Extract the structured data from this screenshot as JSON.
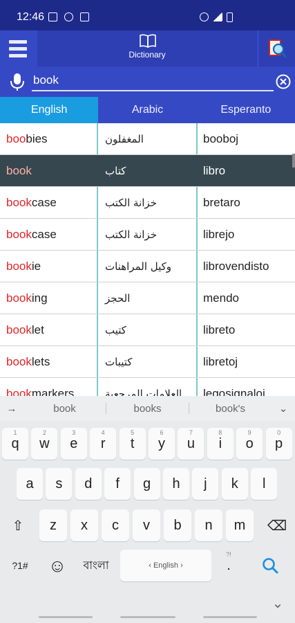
{
  "status_bar": {
    "time": "12:46",
    "left_icons": [
      "image-icon",
      "usb-icon",
      "nfc-icon"
    ],
    "right_icons": [
      "alarm-icon",
      "signal-icon",
      "battery-icon"
    ]
  },
  "header": {
    "title": "Dictionary",
    "menu_icon": "hamburger-menu-icon",
    "book_icon": "open-book-icon",
    "search_dict_icon": "magnifier-dictionary-icon"
  },
  "search": {
    "value": "book",
    "mic_icon": "microphone-icon",
    "clear_icon": "clear-circle-icon"
  },
  "tabs": [
    {
      "label": "English",
      "active": true
    },
    {
      "label": "Arabic",
      "active": false
    },
    {
      "label": "Esperanto",
      "active": false
    }
  ],
  "results": [
    {
      "match": "boo",
      "rest": "bies",
      "arabic": "المغفلون",
      "esperanto": "booboj",
      "selected": false
    },
    {
      "match": "book",
      "rest": "",
      "arabic": "كتاب",
      "esperanto": "libro",
      "selected": true
    },
    {
      "match": "book",
      "rest": "case",
      "arabic": "خزانة الكتب",
      "esperanto": "bretaro",
      "selected": false
    },
    {
      "match": "book",
      "rest": "case",
      "arabic": "خزانة الكتب",
      "esperanto": "librejo",
      "selected": false
    },
    {
      "match": "book",
      "rest": "ie",
      "arabic": "وكيل المراهنات",
      "esperanto": "librovendisto",
      "selected": false
    },
    {
      "match": "book",
      "rest": "ing",
      "arabic": "الحجز",
      "esperanto": "mendo",
      "selected": false
    },
    {
      "match": "book",
      "rest": "let",
      "arabic": "كتيب",
      "esperanto": "libreto",
      "selected": false
    },
    {
      "match": "book",
      "rest": "lets",
      "arabic": "كتيبات",
      "esperanto": "libretoj",
      "selected": false
    },
    {
      "match": "book",
      "rest": "markers",
      "arabic": "العلامات المرجعية",
      "esperanto": "legosignaloj",
      "selected": false
    }
  ],
  "suggestions": {
    "arrow": "→",
    "words": [
      "book",
      "books",
      "book's"
    ],
    "expand": "⌄"
  },
  "keyboard": {
    "row1": [
      {
        "k": "q",
        "h": "1"
      },
      {
        "k": "w",
        "h": "2"
      },
      {
        "k": "e",
        "h": "3"
      },
      {
        "k": "r",
        "h": "4"
      },
      {
        "k": "t",
        "h": "5"
      },
      {
        "k": "y",
        "h": "6"
      },
      {
        "k": "u",
        "h": "7"
      },
      {
        "k": "i",
        "h": "8"
      },
      {
        "k": "o",
        "h": "9"
      },
      {
        "k": "p",
        "h": "0"
      }
    ],
    "row2": [
      "a",
      "s",
      "d",
      "f",
      "g",
      "h",
      "j",
      "k",
      "l"
    ],
    "row3": [
      "z",
      "x",
      "c",
      "v",
      "b",
      "n",
      "m"
    ],
    "shift": "⇧",
    "backspace": "⌫",
    "symbols": "?1#",
    "emoji": "☺",
    "language_key": "বাংলা",
    "space": "‹ English ›",
    "period": ".",
    "period_hint": "?!",
    "search_key": "search-icon",
    "collapse": "⌄"
  }
}
